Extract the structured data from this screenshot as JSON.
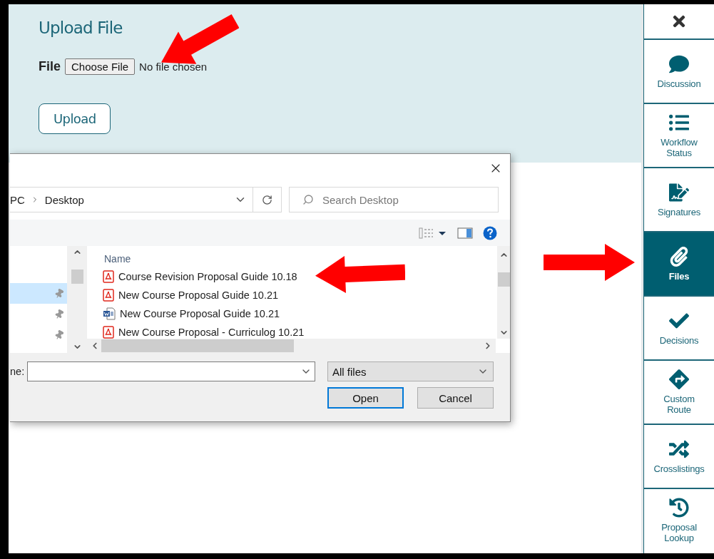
{
  "upload_panel": {
    "title": "Upload File",
    "file_label": "File",
    "choose_button": "Choose File",
    "file_status": "No file chosen",
    "upload_button": "Upload"
  },
  "file_dialog": {
    "breadcrumb": [
      "PC",
      "Desktop"
    ],
    "search": {
      "placeholder": "Search Desktop"
    },
    "nav_items": [
      {
        "selected": true,
        "pinned": true
      },
      {
        "selected": false,
        "pinned": true
      },
      {
        "selected": false,
        "pinned": true
      }
    ],
    "column": "Name",
    "files": [
      {
        "name": "Course Revision Proposal Guide 10.18",
        "kind": "pdf"
      },
      {
        "name": "New Course Proposal Guide 10.21",
        "kind": "pdf"
      },
      {
        "name": "New Course Proposal Guide 10.21",
        "kind": "word"
      },
      {
        "name": "New Course Proposal - Curriculog 10.21",
        "kind": "pdf"
      }
    ],
    "file_name_label": "ne:",
    "filter": "All files",
    "buttons": [
      {
        "label": "Open",
        "default": true
      },
      {
        "label": "Cancel",
        "default": false
      }
    ]
  },
  "sidebar": {
    "items": [
      {
        "label": "Discussion",
        "kind": "chat",
        "selected": false
      },
      {
        "label": "Workflow Status",
        "kind": "list",
        "selected": false
      },
      {
        "label": "Signatures",
        "kind": "signature",
        "selected": false
      },
      {
        "label": "Files",
        "kind": "paperclip",
        "selected": true
      },
      {
        "label": "Decisions",
        "kind": "check",
        "selected": false
      },
      {
        "label": "Custom Route",
        "kind": "route",
        "selected": false
      },
      {
        "label": "Crosslistings",
        "kind": "shuffle",
        "selected": false
      },
      {
        "label": "Proposal Lookup",
        "kind": "history",
        "selected": false
      }
    ]
  }
}
